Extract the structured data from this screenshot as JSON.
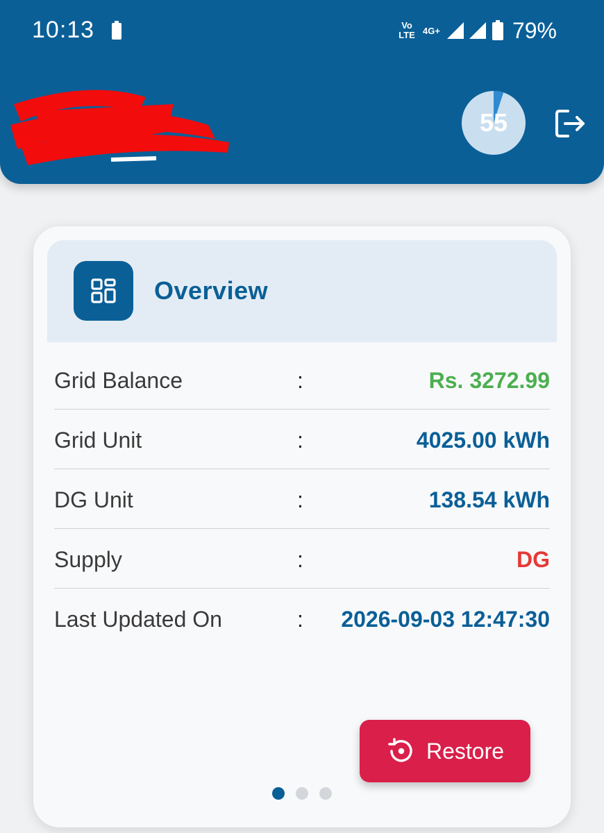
{
  "status_bar": {
    "time": "10:13",
    "volte_top": "Vo",
    "volte_bottom": "LTE",
    "network": "4G+",
    "battery_percent": "79%"
  },
  "header": {
    "user_name_redacted": true,
    "progress_value": "55",
    "progress_fraction": 0.05,
    "logout_icon": "logout-icon"
  },
  "overview": {
    "title": "Overview",
    "icon": "grid-icon",
    "rows": [
      {
        "label": "Grid Balance",
        "separator": ":",
        "value": "Rs. 3272.99",
        "color": "#4caf50"
      },
      {
        "label": "Grid Unit",
        "separator": ":",
        "value": "4025.00 kWh",
        "color": "#0a5f97"
      },
      {
        "label": "DG Unit",
        "separator": ":",
        "value": "138.54 kWh",
        "color": "#0a5f97"
      },
      {
        "label": "Supply",
        "separator": ":",
        "value": "DG",
        "color": "#e53935"
      },
      {
        "label": "Last Updated On",
        "separator": ":",
        "value": "2026-09-03 12:47:30",
        "color": "#0a5f97"
      }
    ],
    "restore_button": {
      "label": "Restore",
      "icon": "restore-icon",
      "color": "#d91f4a"
    },
    "pager": {
      "count": 3,
      "active_index": 0
    }
  },
  "colors": {
    "primary": "#0a5f97",
    "background": "#f0f1f3"
  }
}
